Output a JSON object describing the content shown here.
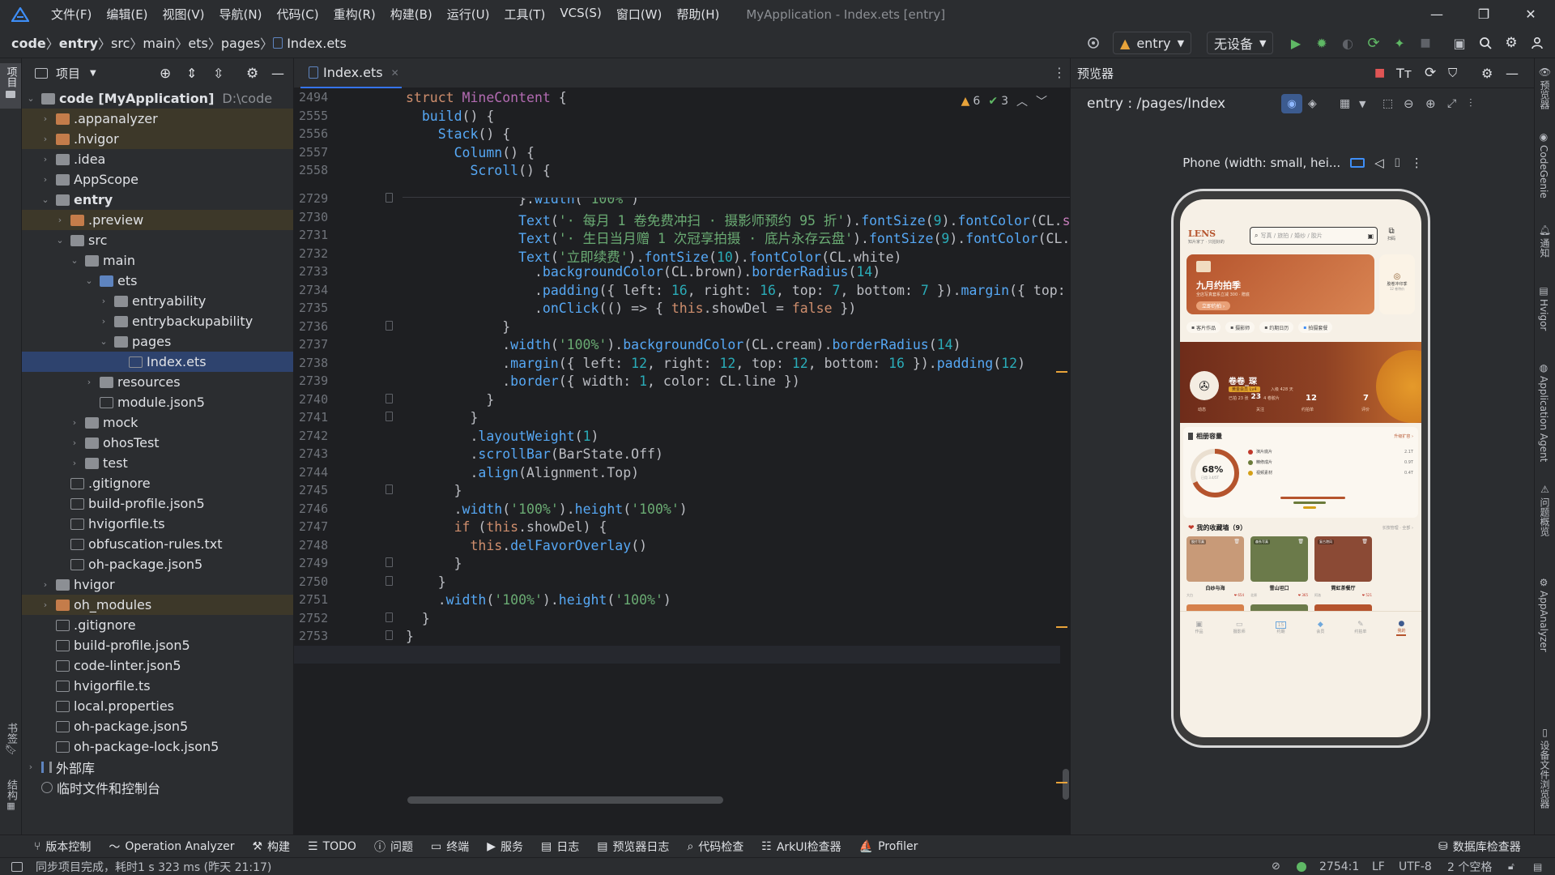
{
  "window": {
    "menu": [
      "文件(F)",
      "编辑(E)",
      "视图(V)",
      "导航(N)",
      "代码(C)",
      "重构(R)",
      "构建(B)",
      "运行(U)",
      "工具(T)",
      "VCS(S)",
      "窗口(W)",
      "帮助(H)"
    ],
    "title": "MyApplication - Index.ets [entry]"
  },
  "breadcrumb": [
    "code",
    "entry",
    "src",
    "main",
    "ets",
    "pages",
    "Index.ets"
  ],
  "toolbar": {
    "run_config": "entry",
    "device": "无设备"
  },
  "left_stripe": {
    "project": "项目",
    "bookmarks": "书签",
    "structure": "结构"
  },
  "project_panel": {
    "title": "项目",
    "root": "code [MyApplication]",
    "root_path": "D:\\code",
    "items": [
      {
        "label": ".appanalyzer",
        "depth": 1,
        "kind": "folder-orange",
        "chev": "›"
      },
      {
        "label": ".hvigor",
        "depth": 1,
        "kind": "folder-orange",
        "chev": "›"
      },
      {
        "label": ".idea",
        "depth": 1,
        "kind": "folder",
        "chev": "›"
      },
      {
        "label": "AppScope",
        "depth": 1,
        "kind": "folder",
        "chev": "›"
      },
      {
        "label": "entry",
        "depth": 1,
        "kind": "folder",
        "chev": "⌄"
      },
      {
        "label": ".preview",
        "depth": 2,
        "kind": "folder-orange",
        "chev": "›"
      },
      {
        "label": "src",
        "depth": 2,
        "kind": "folder",
        "chev": "⌄"
      },
      {
        "label": "main",
        "depth": 3,
        "kind": "folder",
        "chev": "⌄"
      },
      {
        "label": "ets",
        "depth": 4,
        "kind": "folder-blue",
        "chev": "⌄"
      },
      {
        "label": "entryability",
        "depth": 5,
        "kind": "folder",
        "chev": "›"
      },
      {
        "label": "entrybackupability",
        "depth": 5,
        "kind": "folder",
        "chev": "›"
      },
      {
        "label": "pages",
        "depth": 5,
        "kind": "folder",
        "chev": "⌄"
      },
      {
        "label": "Index.ets",
        "depth": 6,
        "kind": "file",
        "chev": ""
      },
      {
        "label": "resources",
        "depth": 4,
        "kind": "folder",
        "chev": "›"
      },
      {
        "label": "module.json5",
        "depth": 4,
        "kind": "file",
        "chev": ""
      },
      {
        "label": "mock",
        "depth": 3,
        "kind": "folder",
        "chev": "›"
      },
      {
        "label": "ohosTest",
        "depth": 3,
        "kind": "folder",
        "chev": "›"
      },
      {
        "label": "test",
        "depth": 3,
        "kind": "folder",
        "chev": "›"
      },
      {
        "label": ".gitignore",
        "depth": 2,
        "kind": "file",
        "chev": ""
      },
      {
        "label": "build-profile.json5",
        "depth": 2,
        "kind": "file",
        "chev": ""
      },
      {
        "label": "hvigorfile.ts",
        "depth": 2,
        "kind": "file",
        "chev": ""
      },
      {
        "label": "obfuscation-rules.txt",
        "depth": 2,
        "kind": "file",
        "chev": ""
      },
      {
        "label": "oh-package.json5",
        "depth": 2,
        "kind": "file",
        "chev": ""
      },
      {
        "label": "hvigor",
        "depth": 1,
        "kind": "folder",
        "chev": "›"
      },
      {
        "label": "oh_modules",
        "depth": 1,
        "kind": "folder-orange",
        "chev": "›"
      },
      {
        "label": ".gitignore",
        "depth": 1,
        "kind": "file",
        "chev": ""
      },
      {
        "label": "build-profile.json5",
        "depth": 1,
        "kind": "file",
        "chev": ""
      },
      {
        "label": "code-linter.json5",
        "depth": 1,
        "kind": "file",
        "chev": ""
      },
      {
        "label": "hvigorfile.ts",
        "depth": 1,
        "kind": "file",
        "chev": ""
      },
      {
        "label": "local.properties",
        "depth": 1,
        "kind": "file",
        "chev": ""
      },
      {
        "label": "oh-package.json5",
        "depth": 1,
        "kind": "file",
        "chev": ""
      },
      {
        "label": "oh-package-lock.json5",
        "depth": 1,
        "kind": "file",
        "chev": ""
      },
      {
        "label": "外部库",
        "depth": 0,
        "kind": "lib",
        "chev": "›"
      },
      {
        "label": "临时文件和控制台",
        "depth": 0,
        "kind": "console",
        "chev": ""
      }
    ]
  },
  "editor": {
    "tab": "Index.ets",
    "warnings": "6",
    "checks": "3",
    "sticky_lines": [
      {
        "num": "2494",
        "html": "<span class='kw'>struct</span> <span class='ty'>MineContent</span> {"
      },
      {
        "num": "2555",
        "html": "  <span class='fn'>build</span>() {"
      },
      {
        "num": "2556",
        "html": "    <span class='fn'>Stack</span>() {"
      },
      {
        "num": "2557",
        "html": "      <span class='fn'>Column</span>() {"
      },
      {
        "num": "2558",
        "html": "        <span class='fn'>Scroll</span>() {"
      }
    ],
    "lines": [
      {
        "num": "2729",
        "html": "              }.<span class='fn'>width</span>(<span class='str'>'100%'</span>)"
      },
      {
        "num": "2730",
        "html": "              <span class='fn'>Text</span>(<span class='str'>'· 每月 1 卷免费冲扫 · 摄影师预约 95 折'</span>).<span class='fn'>fontSize</span>(<span class='num'>9</span>).<span class='fn'>fontColor</span>(CL.<span class='fd'>s</span>"
      },
      {
        "num": "2731",
        "html": "              <span class='fn'>Text</span>(<span class='str'>'· 生日当月赠 1 次冠享拍摄 · 底片永存云盘'</span>).<span class='fn'>fontSize</span>(<span class='num'>9</span>).<span class='fn'>fontColor</span>(CL.<span class='fd'>…</span>"
      },
      {
        "num": "2732",
        "html": "              <span class='fn'>Text</span>(<span class='str'>'立即续费'</span>).<span class='fn'>fontSize</span>(<span class='num'>10</span>).<span class='fn'>fontColor</span>(CL.white)"
      },
      {
        "num": "2733",
        "html": "                .<span class='fn'>backgroundColor</span>(CL.brown).<span class='fn'>borderRadius</span>(<span class='num'>14</span>)"
      },
      {
        "num": "2734",
        "html": "                .<span class='fn'>padding</span>({ left: <span class='num'>16</span>, right: <span class='num'>16</span>, top: <span class='num'>7</span>, bottom: <span class='num'>7</span> }).<span class='fn'>margin</span>({ top:"
      },
      {
        "num": "2735",
        "html": "                .<span class='fn'>onClick</span>(() => { <span class='kw'>this</span>.showDel = <span class='kw'>false</span> })"
      },
      {
        "num": "2736",
        "html": "            }"
      },
      {
        "num": "2737",
        "html": "            .<span class='fn'>width</span>(<span class='str'>'100%'</span>).<span class='fn'>backgroundColor</span>(CL.cream).<span class='fn'>borderRadius</span>(<span class='num'>14</span>)"
      },
      {
        "num": "2738",
        "html": "            .<span class='fn'>margin</span>({ left: <span class='num'>12</span>, right: <span class='num'>12</span>, top: <span class='num'>12</span>, bottom: <span class='num'>16</span> }).<span class='fn'>padding</span>(<span class='num'>12</span>)"
      },
      {
        "num": "2739",
        "html": "            .<span class='fn'>border</span>({ width: <span class='num'>1</span>, color: CL.line })"
      },
      {
        "num": "2740",
        "html": "          }"
      },
      {
        "num": "2741",
        "html": "        }"
      },
      {
        "num": "2742",
        "html": "        .<span class='fn'>layoutWeight</span>(<span class='num'>1</span>)"
      },
      {
        "num": "2743",
        "html": "        .<span class='fn'>scrollBar</span>(BarState.Off)"
      },
      {
        "num": "2744",
        "html": "        .<span class='fn'>align</span>(Alignment.Top)"
      },
      {
        "num": "2745",
        "html": "      }"
      },
      {
        "num": "2746",
        "html": "      .<span class='fn'>width</span>(<span class='str'>'100%'</span>).<span class='fn'>height</span>(<span class='str'>'100%'</span>)"
      },
      {
        "num": "2747",
        "html": "      <span class='kw'>if</span> (<span class='kw'>this</span>.showDel) {"
      },
      {
        "num": "2748",
        "html": "        <span class='kw'>this</span>.<span class='fn'>delFavorOverlay</span>()"
      },
      {
        "num": "2749",
        "html": "      }"
      },
      {
        "num": "2750",
        "html": "    }"
      },
      {
        "num": "2751",
        "html": "    .<span class='fn'>width</span>(<span class='str'>'100%'</span>).<span class='fn'>height</span>(<span class='str'>'100%'</span>)"
      },
      {
        "num": "2752",
        "html": "  }"
      },
      {
        "num": "2753",
        "html": "}"
      },
      {
        "num": "2754",
        "html": ""
      }
    ]
  },
  "preview": {
    "title": "预览器",
    "route": "entry : /pages/Index",
    "device_label": "Phone (width: small, hei...",
    "app": {
      "brand": "LENS",
      "brand_sub": "知片家了 · 只拍好的",
      "search": "写真 / 旅拍 / 婚纱 / 胶片",
      "scan": "扫码",
      "banner_title": "九月约拍季",
      "banner_sub": "全店写真套系立减 300 · 赠底",
      "banner_btn": "立即约拍 ›",
      "side_card": "胶卷冲印季",
      "side_card_sub": "12 卷特价",
      "chips": [
        "客片作品",
        "摄影师",
        "约期日历",
        "拍摄套餐"
      ],
      "user_name": "卷卷_琛",
      "user_badge": "黄金会员 Lv4",
      "user_stat_a": "入级 428 天",
      "stats": [
        {
          "v": "23",
          "l": "关注"
        },
        {
          "v": "12",
          "l": "约拍单"
        },
        {
          "v": "7",
          "l": "评价"
        }
      ],
      "stat_left_prefix": "已拍 23 张",
      "stat_left_mid": "4 卷胶片",
      "stat_left_label": "动态",
      "storage_title": "相册容量",
      "storage_more": "升级扩容 ›",
      "storage_pct": "68%",
      "storage_sub": "已用 3.4/5T",
      "storage_rows": [
        {
          "label": "演片底片",
          "size": "2.1T",
          "color": "#c0392b"
        },
        {
          "label": "精修成片",
          "size": "0.9T",
          "color": "#6b7a3a"
        },
        {
          "label": "视频素材",
          "size": "0.4T",
          "color": "#d4a017"
        }
      ],
      "fav_title": "我的收藏墙（9）",
      "fav_actions": "长按管理 · 全部 ›",
      "fav_cards": [
        {
          "tag": "胶片写真",
          "name": "白纱与海",
          "by": "大白",
          "likes": "❤ 654",
          "color": "#c89a78"
        },
        {
          "tag": "森系写真",
          "name": "雪山坦口",
          "by": "北原",
          "likes": "❤ 365",
          "color": "#6b7a4a"
        },
        {
          "tag": "复古港风",
          "name": "霓虹茶餐厅",
          "by": "阿洛",
          "likes": "❤ 521",
          "color": "#8b4a35"
        }
      ],
      "tabbar": [
        "作品",
        "摄影师",
        "约期",
        "会员",
        "约拍单",
        "我的"
      ],
      "tabbar_date": "15",
      "brand_color": "#b5542d"
    }
  },
  "right_stripe": [
    "预览器",
    "CodeGenie",
    "通知",
    "Hvigor",
    "Application Agent",
    "问题概览",
    "AppAnalyzer",
    "设备文件浏览器"
  ],
  "tool_windows": [
    "版本控制",
    "Operation Analyzer",
    "构建",
    "TODO",
    "问题",
    "终端",
    "服务",
    "日志",
    "预览器日志",
    "代码检查",
    "ArkUI检查器",
    "Profiler"
  ],
  "tool_right": "数据库检查器",
  "status": {
    "message": "同步项目完成，耗时1 s 323 ms (昨天 21:17)",
    "position": "2754:1",
    "line_sep": "LF",
    "encoding": "UTF-8",
    "indent": "2 个空格"
  }
}
